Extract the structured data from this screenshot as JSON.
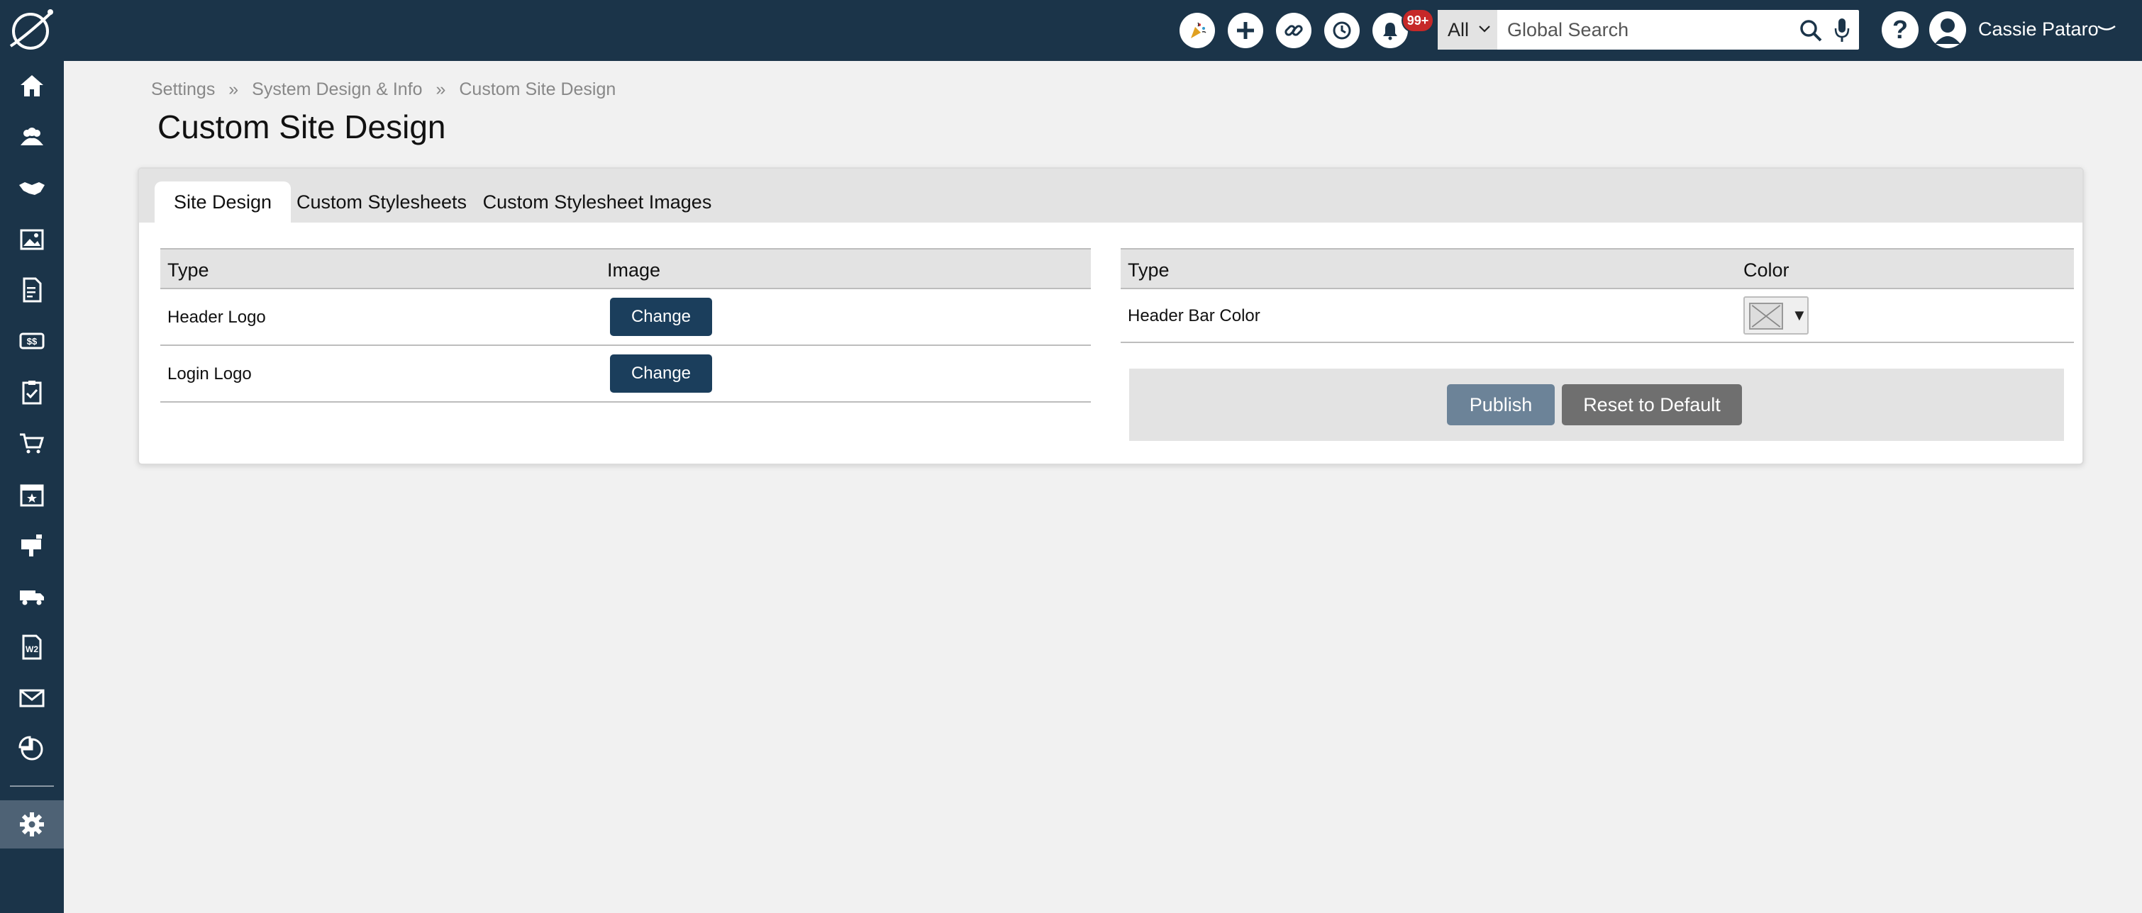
{
  "topbar": {
    "icons": [
      "celebration-icon",
      "plus-icon",
      "link-icon",
      "history-icon",
      "bell-icon"
    ],
    "notification_badge": "99+",
    "search": {
      "scope": "All",
      "placeholder": "Global Search"
    },
    "help_label": "?",
    "user_name": "Cassie Pataro"
  },
  "sidebar": {
    "items": [
      "home",
      "contacts",
      "deals",
      "gallery",
      "invoices",
      "billing",
      "tasks",
      "cart",
      "events",
      "mailbox",
      "shipping",
      "w2",
      "email",
      "reports",
      "settings"
    ],
    "active": "settings"
  },
  "breadcrumb": {
    "items": [
      "Settings",
      "System Design & Info",
      "Custom Site Design"
    ],
    "separator": "»"
  },
  "page": {
    "title": "Custom Site Design"
  },
  "tabs": [
    {
      "label": "Site Design",
      "active": true
    },
    {
      "label": "Custom Stylesheets",
      "active": false
    },
    {
      "label": "Custom Stylesheet Images",
      "active": false
    }
  ],
  "images_table": {
    "headers": [
      "Type",
      "Image"
    ],
    "rows": [
      {
        "type": "Header Logo",
        "action": "Change"
      },
      {
        "type": "Login Logo",
        "action": "Change"
      }
    ]
  },
  "colors_table": {
    "headers": [
      "Type",
      "Color"
    ],
    "rows": [
      {
        "type": "Header Bar Color",
        "picker_arrow": "▼"
      }
    ]
  },
  "actions": {
    "publish_label": "Publish",
    "reset_label": "Reset to Default"
  },
  "colors": {
    "topbar_bg": "#1b3449",
    "primary_button": "#1b3e5c",
    "publish_button": "#6c8398",
    "reset_button": "#6f6f6f",
    "badge": "#c62828"
  }
}
